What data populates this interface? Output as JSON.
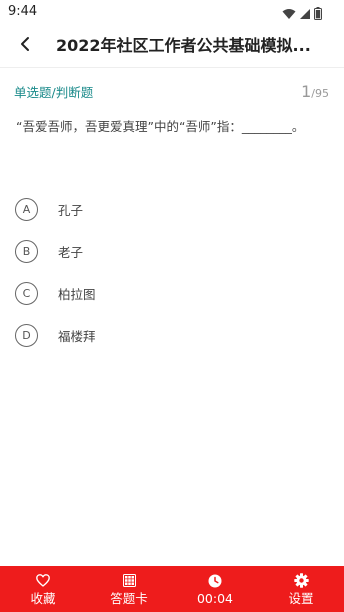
{
  "status_bar": {
    "time": "9:44",
    "icons": [
      "wifi-icon",
      "signal-icon",
      "battery-icon"
    ]
  },
  "nav": {
    "back_icon": "chevron-left-icon",
    "title": "2022年社区工作者公共基础模拟..."
  },
  "question": {
    "type": "单选题/判断题",
    "current": "1",
    "total": "/95",
    "text": "“吾爱吾师，吾更爱真理”中的“吾师”指：________。"
  },
  "options": [
    {
      "letter": "A",
      "text": "孔子"
    },
    {
      "letter": "B",
      "text": "老子"
    },
    {
      "letter": "C",
      "text": "柏拉图"
    },
    {
      "letter": "D",
      "text": "福楼拜"
    }
  ],
  "tab_bar": {
    "items": [
      {
        "label": "收藏",
        "icon": "heart-icon"
      },
      {
        "label": "答题卡",
        "icon": "grid-icon"
      },
      {
        "label": "00:04",
        "icon": "clock-icon"
      },
      {
        "label": "设置",
        "icon": "gear-icon"
      }
    ]
  },
  "colors": {
    "accent": "#ee1c1c",
    "type_text": "#1a8a8a"
  }
}
